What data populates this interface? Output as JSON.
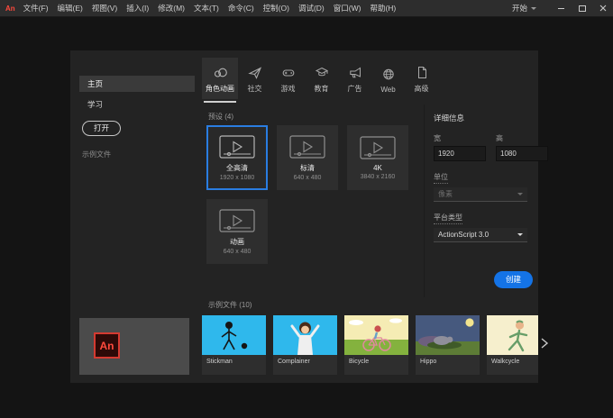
{
  "window": {
    "logo": "An",
    "start": "开始"
  },
  "menu": {
    "items": [
      "文件(F)",
      "编辑(E)",
      "视图(V)",
      "插入(I)",
      "修改(M)",
      "文本(T)",
      "命令(C)",
      "控制(O)",
      "调试(D)",
      "窗口(W)",
      "帮助(H)"
    ]
  },
  "sidebar": {
    "home": "主页",
    "learn": "学习",
    "open": "打开",
    "samples_link": "示例文件"
  },
  "tabs": [
    {
      "label": "角色动画",
      "icon": "character-animation-icon",
      "selected": true
    },
    {
      "label": "社交",
      "icon": "paper-plane-icon",
      "selected": false
    },
    {
      "label": "游戏",
      "icon": "game-controller-icon",
      "selected": false
    },
    {
      "label": "教育",
      "icon": "graduation-cap-icon",
      "selected": false
    },
    {
      "label": "广告",
      "icon": "megaphone-icon",
      "selected": false
    },
    {
      "label": "Web",
      "icon": "globe-icon",
      "selected": false
    },
    {
      "label": "高级",
      "icon": "document-icon",
      "selected": false
    }
  ],
  "presets": {
    "header": "预设 (4)",
    "cards": [
      {
        "name": "全高清",
        "dims": "1920 x 1080",
        "selected": true
      },
      {
        "name": "标清",
        "dims": "640 x 480",
        "selected": false
      },
      {
        "name": "4K",
        "dims": "3840 x 2160",
        "selected": false
      },
      {
        "name": "动画",
        "dims": "640 x 480",
        "selected": false
      }
    ]
  },
  "details": {
    "header": "详细信息",
    "width_label": "宽",
    "width_value": "1920",
    "height_label": "高",
    "height_value": "1080",
    "units_label": "单位",
    "units_value": "像素",
    "platform_label": "平台类型",
    "platform_value": "ActionScript 3.0",
    "create": "创建"
  },
  "samples": {
    "header": "示例文件 (10)",
    "cards": [
      {
        "name": "Stickman"
      },
      {
        "name": "Complainer"
      },
      {
        "name": "Bicycle"
      },
      {
        "name": "Hippo"
      },
      {
        "name": "Walkcycle"
      }
    ]
  },
  "colors": {
    "accent": "#1473e6",
    "selection_border": "#2a7de1",
    "titlebar": "#2d2d2d",
    "panel": "#232323",
    "logo_red": "#ff4a3d",
    "sample_cyan": "#2fb8ec"
  }
}
